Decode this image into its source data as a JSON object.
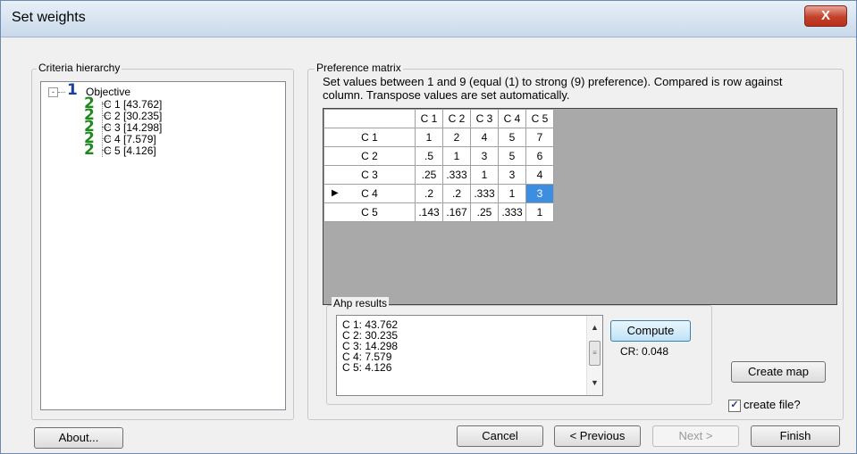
{
  "window": {
    "title": "Set weights",
    "close_label": "X"
  },
  "criteria": {
    "label": "Criteria hierarchy",
    "root": {
      "level": "1",
      "label": "Objective",
      "expander": "-"
    },
    "children": [
      {
        "level": "2",
        "label": "C 1 [43.762]"
      },
      {
        "level": "2",
        "label": "C 2 [30.235]"
      },
      {
        "level": "2",
        "label": "C 3 [14.298]"
      },
      {
        "level": "2",
        "label": "C 4 [7.579]"
      },
      {
        "level": "2",
        "label": "C 5 [4.126]"
      }
    ]
  },
  "preference": {
    "label": "Preference matrix",
    "description": "Set values between 1 and 9 (equal (1) to strong (9) preference). Compared is row against column. Transpose values are set automatically.",
    "columns": [
      "C 1",
      "C 2",
      "C 3",
      "C 4",
      "C 5"
    ],
    "rows": [
      {
        "header": "C 1",
        "values": [
          "1",
          "2",
          "4",
          "5",
          "7"
        ]
      },
      {
        "header": "C 2",
        "values": [
          ".5",
          "1",
          "3",
          "5",
          "6"
        ]
      },
      {
        "header": "C 3",
        "values": [
          ".25",
          ".333",
          "1",
          "3",
          "4"
        ]
      },
      {
        "header": "C 4",
        "values": [
          ".2",
          ".2",
          ".333",
          "1",
          "3"
        ]
      },
      {
        "header": "C 5",
        "values": [
          ".143",
          ".167",
          ".25",
          ".333",
          "1"
        ]
      }
    ],
    "current_row_marker": "▶",
    "selected_cell": {
      "row": 3,
      "col": 4
    }
  },
  "ahp": {
    "label": "Ahp results",
    "lines": [
      "C 1: 43.762",
      "C 2: 30.235",
      "C 3: 14.298",
      "C 4: 7.579",
      "C 5: 4.126"
    ],
    "compute_label": "Compute",
    "cr_text": "CR: 0.048"
  },
  "create_map_label": "Create map",
  "create_file": {
    "label": "create file?",
    "checked": true,
    "check_glyph": "✓"
  },
  "footer": {
    "about": "About...",
    "cancel": "Cancel",
    "previous": "< Previous",
    "next": "Next >",
    "finish": "Finish"
  },
  "colors": {
    "selection": "#3d8ee0",
    "close_button": "#c2412b",
    "level1": "#1a3fa0",
    "level2": "#1e8a1e"
  }
}
